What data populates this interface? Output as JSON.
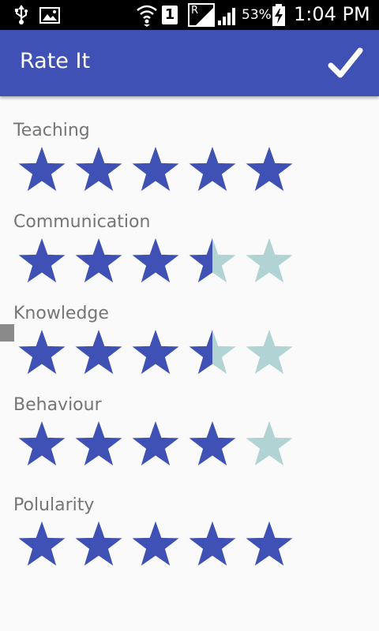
{
  "status_bar": {
    "sim_slot": "1",
    "network_label": "R",
    "battery_percent": "53%",
    "time": "1:04 PM",
    "icons": [
      "usb-icon",
      "image-icon",
      "wifi-icon",
      "sim-icon",
      "signal-icon",
      "signal-icon",
      "battery-charging-icon"
    ]
  },
  "app_bar": {
    "title": "Rate It",
    "confirm_icon": "check-icon",
    "color": "#3f51b5"
  },
  "ratings": [
    {
      "label": "Teaching",
      "value": 5,
      "max": 5
    },
    {
      "label": "Communication",
      "value": 3.5,
      "max": 5
    },
    {
      "label": "Knowledge",
      "value": 3.5,
      "max": 5
    },
    {
      "label": "Behaviour",
      "value": 4,
      "max": 5
    },
    {
      "label": "Polularity",
      "value": 5,
      "max": 5
    }
  ],
  "colors": {
    "star_filled": "#3f51b5",
    "star_empty": "#b2d3d3",
    "label_text": "#757575",
    "background": "#fafafa"
  }
}
